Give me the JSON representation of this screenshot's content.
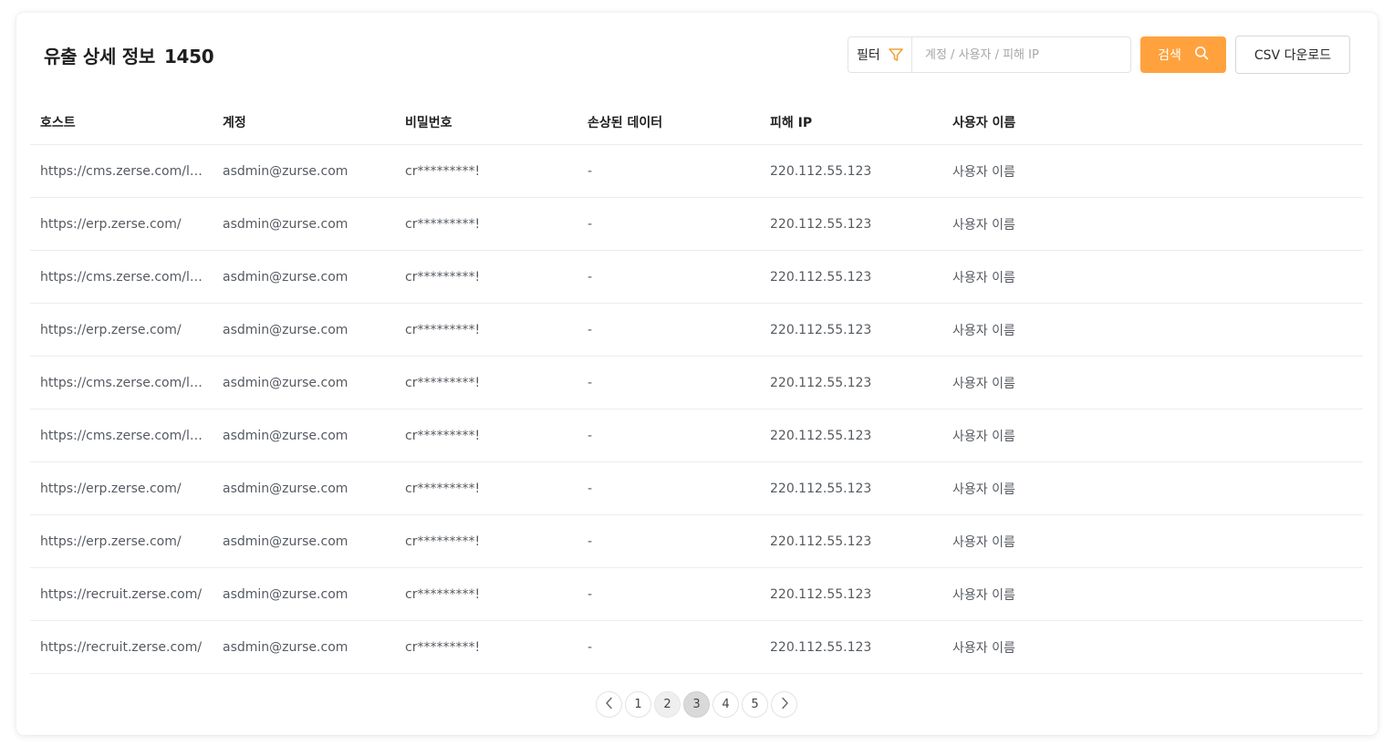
{
  "header": {
    "title": "유출 상세 정보",
    "count": "1450"
  },
  "search": {
    "filter_label": "필터",
    "placeholder": "계정 / 사용자 / 피해 IP",
    "value": "",
    "search_button_label": "검색",
    "csv_button_label": "CSV 다운로드"
  },
  "table": {
    "columns": [
      "호스트",
      "계정",
      "비밀번호",
      "손상된 데이터",
      "피해 IP",
      "사용자 이름"
    ],
    "rows": [
      [
        "https://cms.zerse.com/login",
        "asdmin@zurse.com",
        "cr*********!",
        "-",
        "220.112.55.123",
        "사용자 이름"
      ],
      [
        "https://erp.zerse.com/",
        "asdmin@zurse.com",
        "cr*********!",
        "-",
        "220.112.55.123",
        "사용자 이름"
      ],
      [
        "https://cms.zerse.com/login",
        "asdmin@zurse.com",
        "cr*********!",
        "-",
        "220.112.55.123",
        "사용자 이름"
      ],
      [
        "https://erp.zerse.com/",
        "asdmin@zurse.com",
        "cr*********!",
        "-",
        "220.112.55.123",
        "사용자 이름"
      ],
      [
        "https://cms.zerse.com/login",
        "asdmin@zurse.com",
        "cr*********!",
        "-",
        "220.112.55.123",
        "사용자 이름"
      ],
      [
        "https://cms.zerse.com/login",
        "asdmin@zurse.com",
        "cr*********!",
        "-",
        "220.112.55.123",
        "사용자 이름"
      ],
      [
        "https://erp.zerse.com/",
        "asdmin@zurse.com",
        "cr*********!",
        "-",
        "220.112.55.123",
        "사용자 이름"
      ],
      [
        "https://erp.zerse.com/",
        "asdmin@zurse.com",
        "cr*********!",
        "-",
        "220.112.55.123",
        "사용자 이름"
      ],
      [
        "https://recruit.zerse.com/",
        "asdmin@zurse.com",
        "cr*********!",
        "-",
        "220.112.55.123",
        "사용자 이름"
      ],
      [
        "https://recruit.zerse.com/",
        "asdmin@zurse.com",
        "cr*********!",
        "-",
        "220.112.55.123",
        "사용자 이름"
      ]
    ]
  },
  "pagination": {
    "pages": [
      "1",
      "2",
      "3",
      "4",
      "5"
    ],
    "current": "3",
    "visited": [
      "2"
    ]
  },
  "colors": {
    "accent": "#ffa23e",
    "filter_icon": "#f0a23a"
  },
  "icons": {
    "filter": "filter-icon",
    "search": "search-icon",
    "prev": "chevron-left-icon",
    "next": "chevron-right-icon"
  }
}
